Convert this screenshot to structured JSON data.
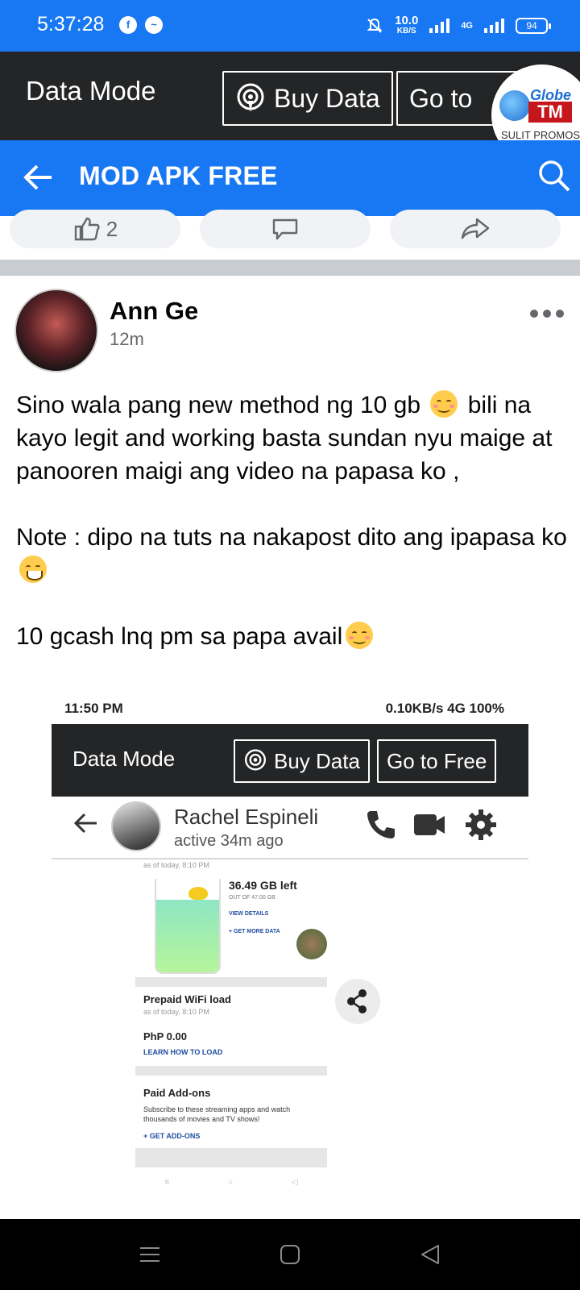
{
  "status_bar": {
    "time": "5:37:28",
    "speed_value": "10.0",
    "speed_unit": "KB/S",
    "network": "4G",
    "battery": "94"
  },
  "data_bar": {
    "label": "Data Mode",
    "buy_label": "Buy Data",
    "goto_label": "Go to"
  },
  "promo_badge": {
    "globe": "Globe",
    "tm": "TM",
    "caption": "SULIT PROMOS"
  },
  "app_bar": {
    "title": "MOD APK FREE"
  },
  "reactions": {
    "like_count": "2"
  },
  "post": {
    "author": "Ann Ge",
    "time": "12m",
    "paragraph1_a": "Sino wala pang new method ng 10 gb",
    "paragraph1_b": "bili na kayo legit and working basta sundan nyu maige at panooren maigi ang video na papasa ko ,",
    "paragraph2": "Note : dipo na tuts na nakapost dito ang ipapasa ko",
    "paragraph3": "10 gcash lnq pm sa papa avail"
  },
  "shared_screenshot": {
    "status_time": "11:50 PM",
    "status_right": "0.10KB/s 4G 100%",
    "data_label": "Data Mode",
    "buy_label": "Buy Data",
    "goto_label": "Go to Free",
    "contact_name": "Rachel Espineli",
    "contact_status": "active 34m ago",
    "as_of": "as of today, 8:10 PM",
    "gb_left": "36.49 GB left",
    "gb_out_of": "OUT OF 47.00 GB",
    "view_details": "VIEW DETAILS",
    "get_more": "+ GET MORE DATA",
    "prepaid_title": "Prepaid WiFi load",
    "prepaid_as_of": "as of today, 8:10 PM",
    "prepaid_amount": "PhP 0.00",
    "learn_load": "LEARN HOW TO LOAD",
    "addons_title": "Paid Add-ons",
    "addons_body": "Subscribe to these streaming apps and watch thousands of movies and TV shows!",
    "get_addons": "+ GET ADD-ONS"
  }
}
